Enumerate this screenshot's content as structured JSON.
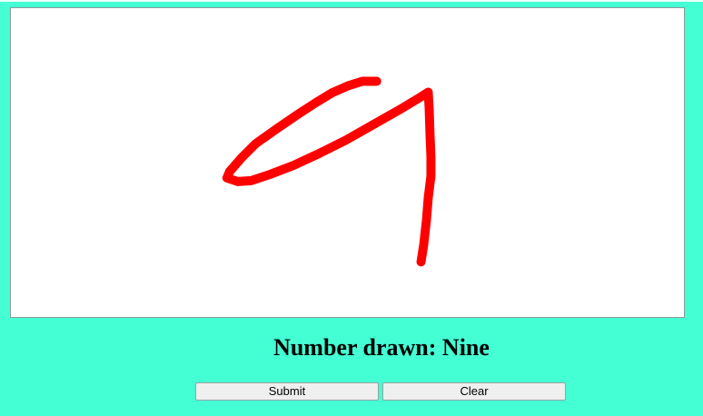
{
  "canvas": {
    "stroke_color": "#ff0000"
  },
  "result": {
    "label": "Number drawn: Nine"
  },
  "buttons": {
    "submit_label": "Submit",
    "clear_label": "Clear"
  },
  "colors": {
    "background": "#44ffd4",
    "canvas_background": "#ffffff"
  }
}
